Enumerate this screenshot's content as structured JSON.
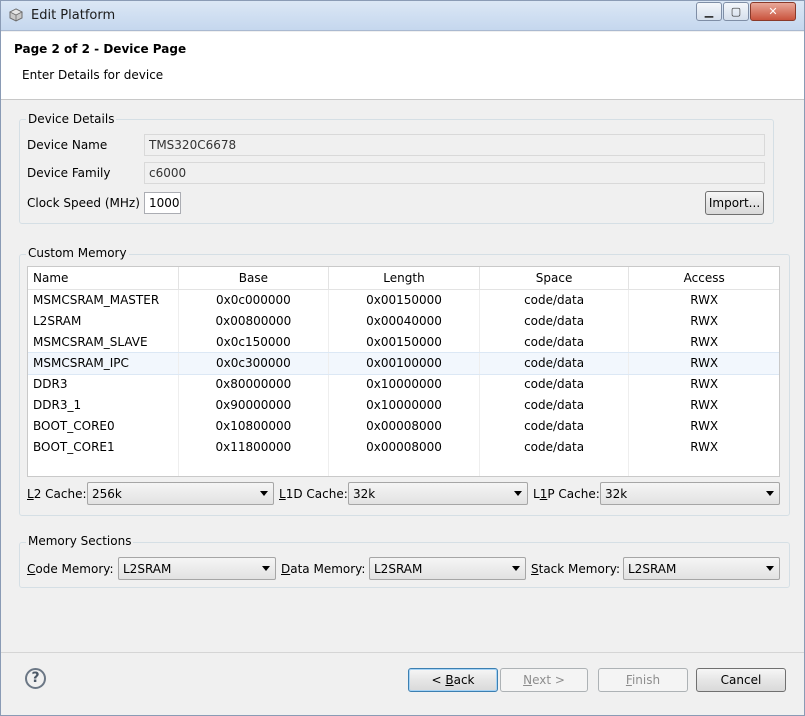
{
  "window": {
    "title": "Edit Platform",
    "controls": {
      "minimize": "▁",
      "maximize": "▢",
      "close": "✕"
    }
  },
  "header": {
    "title_prefix": "Page 2 of 2",
    "title_sep": " - ",
    "title_page": "Device Page",
    "subtitle": "Enter Details for device"
  },
  "device_details": {
    "group_title": "Device Details",
    "device_name_label": "Device Name",
    "device_name_value": "TMS320C6678",
    "device_family_label": "Device Family",
    "device_family_value": "c6000",
    "clock_speed_label": "Clock Speed (MHz)",
    "clock_speed_value": "1000",
    "import_button": "Import..."
  },
  "custom_memory": {
    "group_title": "Custom Memory",
    "columns": [
      "Name",
      "Base",
      "Length",
      "Space",
      "Access"
    ],
    "rows": [
      [
        "MSMCSRAM_MASTER",
        "0x0c000000",
        "0x00150000",
        "code/data",
        "RWX"
      ],
      [
        "L2SRAM",
        "0x00800000",
        "0x00040000",
        "code/data",
        "RWX"
      ],
      [
        "MSMCSRAM_SLAVE",
        "0x0c150000",
        "0x00150000",
        "code/data",
        "RWX"
      ],
      [
        "MSMCSRAM_IPC",
        "0x0c300000",
        "0x00100000",
        "code/data",
        "RWX"
      ],
      [
        "DDR3",
        "0x80000000",
        "0x10000000",
        "code/data",
        "RWX"
      ],
      [
        "DDR3_1",
        "0x90000000",
        "0x10000000",
        "code/data",
        "RWX"
      ],
      [
        "BOOT_CORE0",
        "0x10800000",
        "0x00008000",
        "code/data",
        "RWX"
      ],
      [
        "BOOT_CORE1",
        "0x11800000",
        "0x00008000",
        "code/data",
        "RWX"
      ]
    ],
    "selected_row": 3,
    "l2_cache": {
      "mnemonic": "L",
      "label_rest": "2 Cache:",
      "value": "256k"
    },
    "l1d_cache": {
      "mnemonic": "L",
      "label_rest": "1D Cache:",
      "value": "32k"
    },
    "l1p_cache": {
      "pre": "L",
      "mnemonic": "1",
      "label_rest": "P Cache:",
      "value": "32k"
    }
  },
  "memory_sections": {
    "group_title": "Memory Sections",
    "code_memory": {
      "mnemonic": "C",
      "label_rest": "ode Memory:",
      "value": "L2SRAM"
    },
    "data_memory": {
      "mnemonic": "D",
      "label_rest": "ata Memory:",
      "value": "L2SRAM"
    },
    "stack_memory": {
      "mnemonic": "S",
      "label_rest": "tack Memory:",
      "value": "L2SRAM"
    }
  },
  "footer": {
    "help": "?",
    "back": {
      "pre": "< ",
      "mnemonic": "B",
      "rest": "ack"
    },
    "next": {
      "mnemonic": "N",
      "rest": "ext >"
    },
    "finish": {
      "mnemonic": "F",
      "rest": "inish"
    },
    "cancel": "Cancel"
  }
}
